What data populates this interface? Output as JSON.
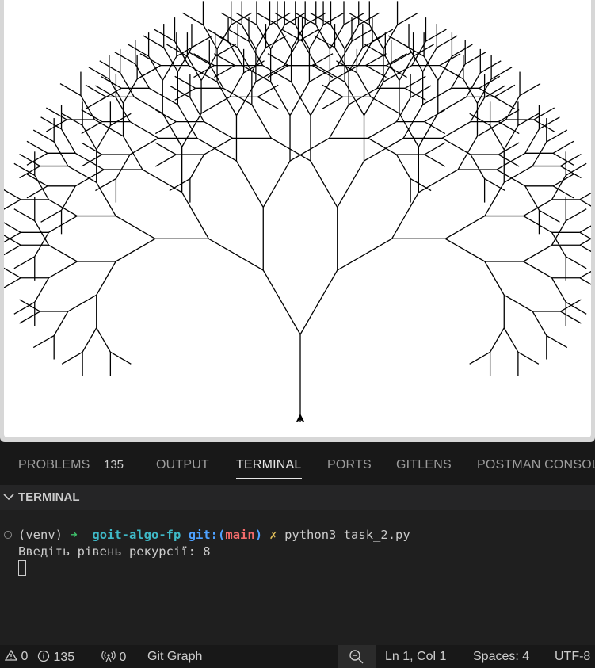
{
  "turtle": {
    "recursion_level": 8,
    "branch_angle_deg": 30,
    "trunk_length": 110,
    "length_factor": 0.85,
    "pen_color": "#000000",
    "background": "#ffffff",
    "turtle_cursor": "arrow-cursor-icon"
  },
  "panel": {
    "tabs": {
      "problems": "PROBLEMS",
      "problems_count": "135",
      "output": "OUTPUT",
      "terminal": "TERMINAL",
      "ports": "PORTS",
      "gitlens": "GITLENS",
      "postman": "POSTMAN CONSOLE"
    },
    "section_title": "TERMINAL"
  },
  "terminal": {
    "venv": "(venv)",
    "arrow": "➜",
    "repo": "goit-algo-fp",
    "git_label": "git:(",
    "branch": "main",
    "git_close": ")",
    "dirty": "✗",
    "command": "python3 task_2.py",
    "output_line": "Введіть рівень рекурсії: 8"
  },
  "status_bar": {
    "errors": "0",
    "warnings": "135",
    "ports": "0",
    "git_graph": "Git Graph",
    "position": "Ln 1, Col 1",
    "spaces": "Spaces: 4",
    "encoding": "UTF-8"
  },
  "colors": {
    "accent": "#e7e7e7",
    "prompt_green": "#3fbf6b",
    "repo_cyan": "#3fb9c7",
    "git_blue": "#4ea1ff",
    "branch_red": "#f36b6b",
    "dirty_yellow": "#e3c05a"
  }
}
